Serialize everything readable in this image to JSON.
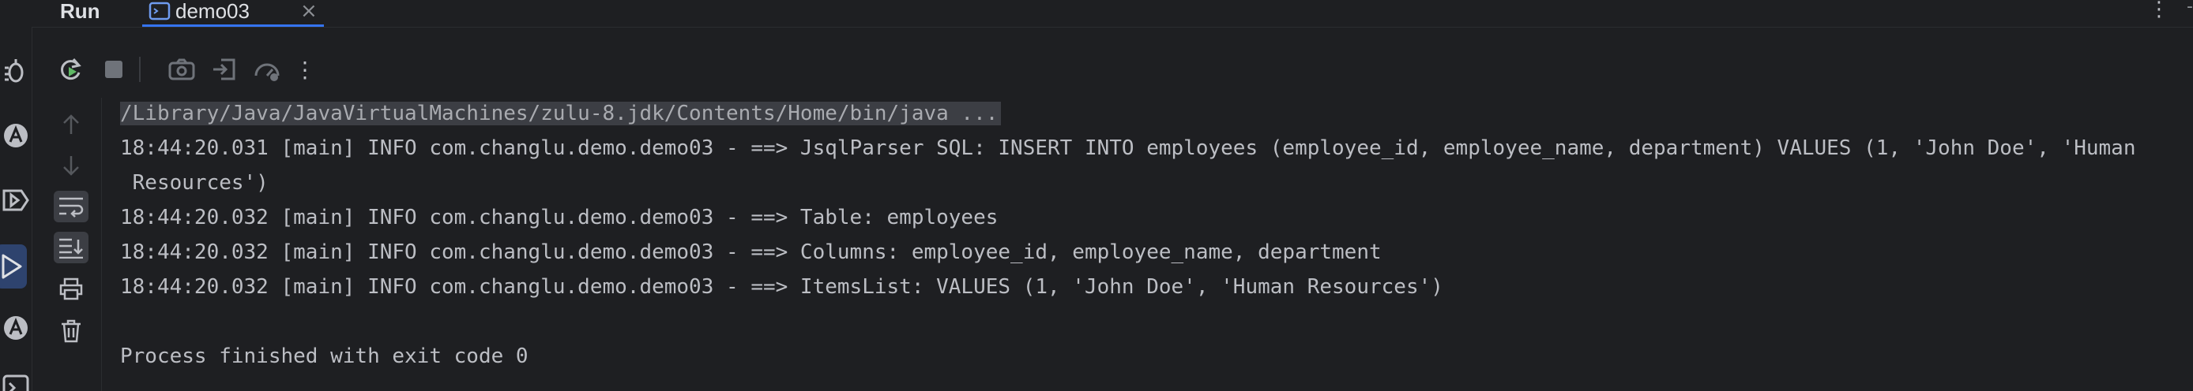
{
  "window": {
    "tool_window_title": "Run"
  },
  "tab": {
    "label": "demo03",
    "icon": "console-window-icon"
  },
  "activity_bar": {
    "icons": [
      "bug-icon",
      "analyze-icon",
      "services-icon",
      "run-icon",
      "analyze-icon",
      "terminal-icon"
    ]
  },
  "toolbar": {
    "buttons": [
      "rerun-icon",
      "stop-icon",
      "screenshot-icon",
      "restore-layout-icon",
      "profile-icon",
      "more-icon"
    ]
  },
  "gutter": {
    "buttons": [
      "up-arrow-icon",
      "down-arrow-icon",
      "soft-wrap-icon",
      "scroll-to-end-icon",
      "print-icon",
      "trash-icon"
    ]
  },
  "console": {
    "command": "/Library/Java/JavaVirtualMachines/zulu-8.jdk/Contents/Home/bin/java ...",
    "lines": [
      "18:44:20.031 [main] INFO com.changlu.demo.demo03 - ==> JsqlParser SQL: INSERT INTO employees (employee_id, employee_name, department) VALUES (1, 'John Doe', 'Human",
      " Resources')",
      "18:44:20.032 [main] INFO com.changlu.demo.demo03 - ==> Table: employees",
      "18:44:20.032 [main] INFO com.changlu.demo.demo03 - ==> Columns: employee_id, employee_name, department",
      "18:44:20.032 [main] INFO com.changlu.demo.demo03 - ==> ItemsList: VALUES (1, 'John Doe', 'Human Resources')",
      "",
      "Process finished with exit code 0"
    ]
  },
  "colors": {
    "background": "#1e1f22",
    "text": "#bcbec4",
    "accent": "#3574f0",
    "active_bg": "#2e436e"
  }
}
